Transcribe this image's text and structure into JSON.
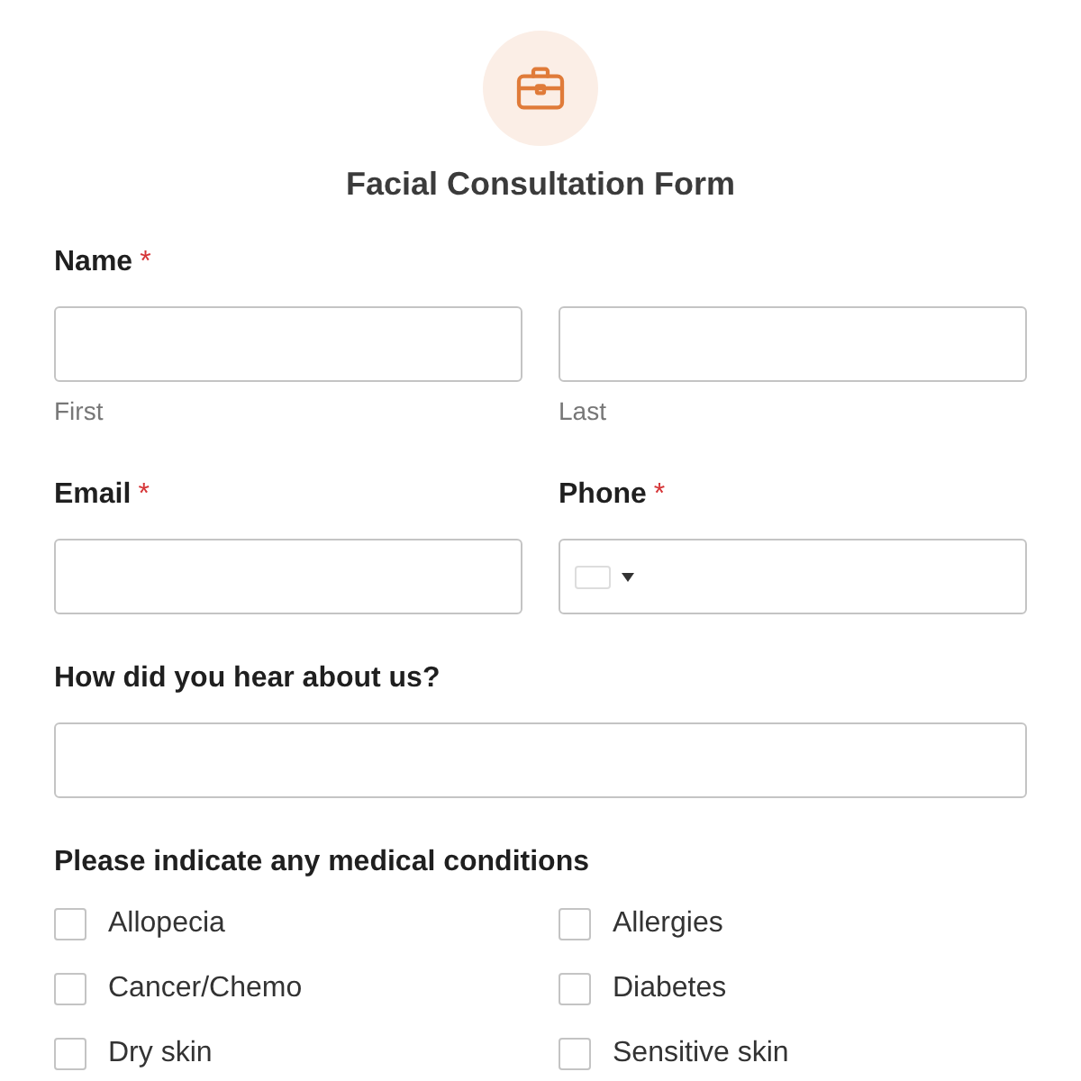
{
  "form": {
    "title": "Facial Consultation Form"
  },
  "fields": [
    {
      "kind": "name",
      "label": "Name",
      "required_mark": "*",
      "sublabels": [
        "First",
        "Last"
      ]
    },
    {
      "kind": "pair",
      "items": [
        {
          "label": "Email",
          "required_mark": "*",
          "kind": "text"
        },
        {
          "label": "Phone",
          "required_mark": "*",
          "kind": "phone"
        }
      ]
    },
    {
      "kind": "text",
      "label": "How did you hear about us?"
    },
    {
      "kind": "checkboxes",
      "label": "Please indicate any medical conditions",
      "options": [
        {
          "label": "Allopecia",
          "checked": false
        },
        {
          "label": "Allergies",
          "checked": false
        },
        {
          "label": "Cancer/Chemo",
          "checked": false
        },
        {
          "label": "Diabetes",
          "checked": false
        },
        {
          "label": "Dry skin",
          "checked": false
        },
        {
          "label": "Sensitive skin",
          "checked": false
        }
      ]
    }
  ]
}
